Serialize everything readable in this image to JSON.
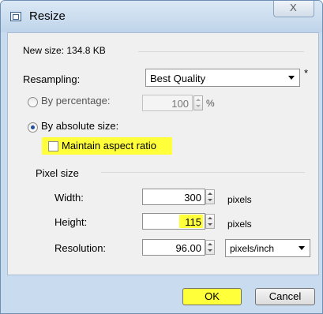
{
  "window": {
    "title": "Resize",
    "close_glyph": "X"
  },
  "info": {
    "new_size": "New size: 134.8 KB"
  },
  "resampling": {
    "label": "Resampling:",
    "value": "Best Quality",
    "marker": "*"
  },
  "by_percentage": {
    "label": "By percentage:",
    "value": "100",
    "unit": "%",
    "selected": false
  },
  "by_absolute": {
    "label": "By absolute size:",
    "selected": true
  },
  "maintain_aspect": {
    "label": "Maintain aspect ratio",
    "checked": false
  },
  "pixel_size": {
    "heading": "Pixel size",
    "width": {
      "label": "Width:",
      "value": "300",
      "unit": "pixels"
    },
    "height": {
      "label": "Height:",
      "value": "115",
      "unit": "pixels"
    },
    "resolution": {
      "label": "Resolution:",
      "value": "96.00",
      "unit": "pixels/inch"
    }
  },
  "buttons": {
    "ok": "OK",
    "cancel": "Cancel"
  },
  "colors": {
    "highlight": "#ffff3a",
    "frame": "#c9dcef",
    "dialog_bg": "#f0f0f0"
  }
}
